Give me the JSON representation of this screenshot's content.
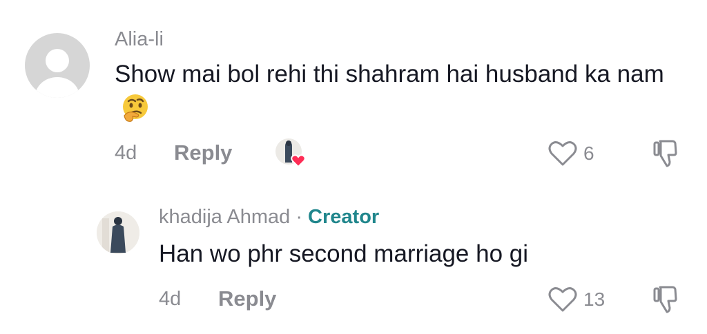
{
  "comment": {
    "username": "Alia-li",
    "text": "Show mai bol rehi thi shahram hai husband ka nam",
    "emoji": "thinking-face",
    "age": "4d",
    "reply_label": "Reply",
    "like_count": "6"
  },
  "reply": {
    "username": "khadija Ahmad",
    "separator": "·",
    "badge": "Creator",
    "text": "Han wo phr second marriage ho gi",
    "age": "4d",
    "reply_label": "Reply",
    "like_count": "13"
  },
  "colors": {
    "text_primary": "#161823",
    "text_secondary": "#8a8b91",
    "creator_badge": "#20868c",
    "creator_like_heart": "#fe2c55"
  }
}
